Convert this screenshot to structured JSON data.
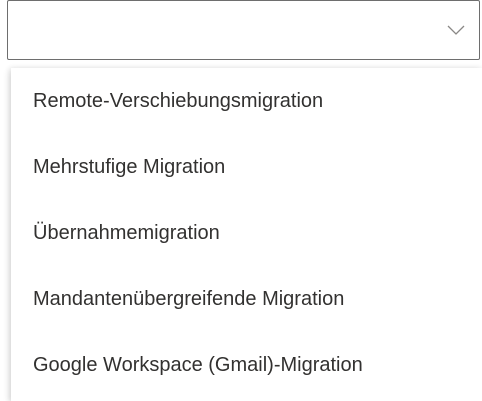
{
  "select": {
    "value": "",
    "chevron_icon": "chevron-down-icon"
  },
  "options": [
    {
      "label": "Remote-Verschiebungsmigration"
    },
    {
      "label": "Mehrstufige Migration"
    },
    {
      "label": "Übernahmemigration"
    },
    {
      "label": "Mandantenübergreifende Migration"
    },
    {
      "label": "Google Workspace (Gmail)-Migration"
    }
  ],
  "colors": {
    "border": "#6e6e6e",
    "text": "#323130",
    "chevron": "#8a8886",
    "panel_bg": "#ffffff"
  }
}
